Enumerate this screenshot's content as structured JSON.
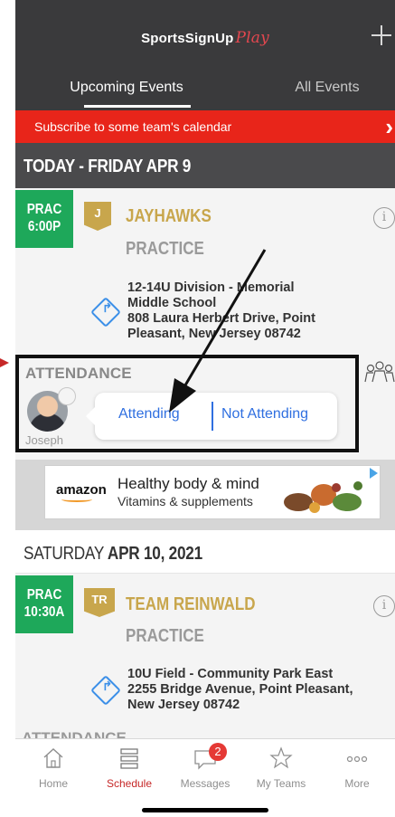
{
  "header": {
    "logo_main": "SportsSignUp",
    "logo_accent": "Play",
    "tabs": [
      "Upcoming Events",
      "All Events"
    ]
  },
  "subscribe_banner": {
    "text": "Subscribe to some team's calendar",
    "close": "›"
  },
  "sections": [
    {
      "date_label": "TODAY - FRIDAY APR 9",
      "event": {
        "time_lines": [
          "PRAC",
          "6:00P"
        ],
        "team_initials": "J",
        "team_name": "JAYHAWKS",
        "event_type": "PRACTICE",
        "address_lines": [
          "12-14U Division - Memorial",
          "Middle School",
          "808 Laura Herbert Drive, Point",
          "Pleasant, New Jersey 08742"
        ],
        "attendance": {
          "label": "ATTENDANCE",
          "person": "Joseph",
          "options": [
            "Attending",
            "Not Attending"
          ]
        }
      }
    },
    {
      "date_label_regular": "SATURDAY",
      "date_label_bold": " APR 10, 2021",
      "event": {
        "time_lines": [
          "PRAC",
          "10:30A"
        ],
        "team_initials": "TR",
        "team_name": "TEAM REINWALD",
        "event_type": "PRACTICE",
        "address_lines": [
          "10U Field - Community Park East",
          "2255 Bridge Avenue, Point Pleasant,",
          "New Jersey 08742"
        ],
        "attendance_label_partial": "ATTENDANCE"
      }
    }
  ],
  "ad": {
    "brand": "amazon",
    "headline": "Healthy body & mind",
    "subline": "Vitamins & supplements"
  },
  "tab_bar": {
    "items": [
      {
        "label": "Home",
        "icon": "home-icon"
      },
      {
        "label": "Schedule",
        "icon": "schedule-icon",
        "active": true
      },
      {
        "label": "Messages",
        "icon": "messages-icon",
        "badge": "2"
      },
      {
        "label": "My Teams",
        "icon": "star-icon"
      },
      {
        "label": "More",
        "icon": "more-icon"
      }
    ]
  },
  "colors": {
    "header_bg": "#3a3a3c",
    "banner_red": "#e8251a",
    "badge_green": "#1ea85a",
    "team_gold": "#c8a64c",
    "link_blue": "#2f6fe0",
    "active_tab": "#c62828"
  }
}
